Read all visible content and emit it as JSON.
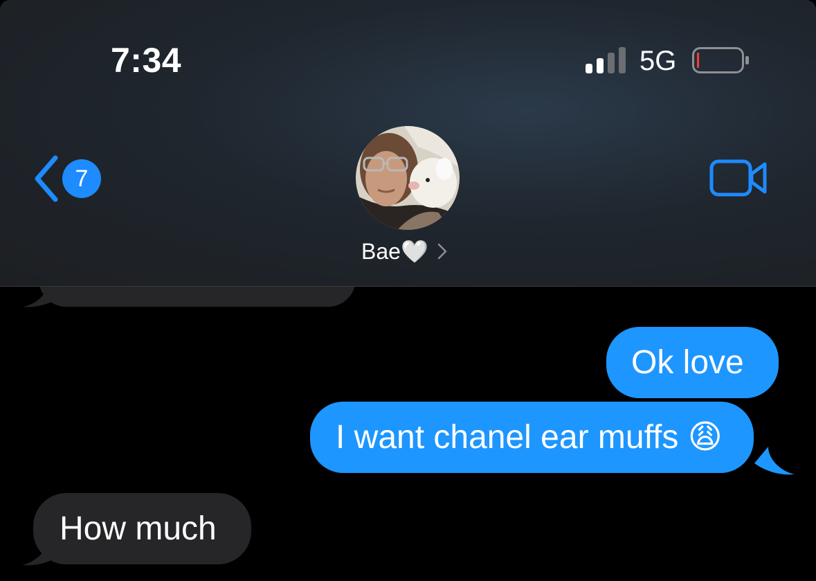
{
  "status_bar": {
    "time": "7:34",
    "network": "5G",
    "signal_bars": 2,
    "battery_level": 0.04
  },
  "header": {
    "back_badge_count": "7",
    "contact_name": "Bae🤍",
    "icons": [
      "back-chevron-icon",
      "video-camera-icon",
      "chevron-right-icon"
    ]
  },
  "messages": [
    {
      "direction": "received",
      "text": ""
    },
    {
      "direction": "sent",
      "text": "Ok love"
    },
    {
      "direction": "sent",
      "text": "I want chanel ear muffs 😩"
    },
    {
      "direction": "received",
      "text": "How much"
    }
  ],
  "colors": {
    "accent": "#1e8bff",
    "sent_bubble": "#1e96ff",
    "received_bubble": "#262628",
    "battery_low": "#ff3b30"
  }
}
